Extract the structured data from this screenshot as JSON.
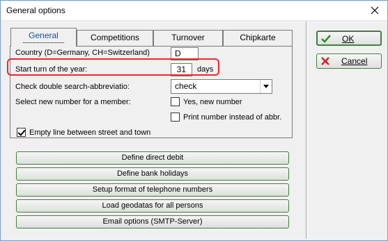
{
  "window": {
    "title": "General options"
  },
  "tabs": [
    {
      "label": "General",
      "active": true
    },
    {
      "label": "Competitions",
      "active": false
    },
    {
      "label": "Turnover",
      "active": false
    },
    {
      "label": "Chipkarte",
      "active": false
    }
  ],
  "general": {
    "country_label": "Country (D=Germany, CH=Switzerland)",
    "country_value": "D",
    "start_turn_label": "Start turn of the year:",
    "start_turn_value": "31",
    "start_turn_unit": "days",
    "double_search_label": "Check double search-abbreviatio:",
    "double_search_value": "check",
    "new_number_label": "Select new number for a member:",
    "yes_new_number_label": "Yes, new number",
    "yes_new_number_checked": false,
    "print_number_label": "Print number instead of abbr.",
    "print_number_checked": false,
    "empty_line_label": "Empty line between street and town",
    "empty_line_checked": true
  },
  "actions": [
    "Define direct debit",
    "Define bank holidays",
    "Setup format of telephone numbers",
    "Load geodatas for all persons",
    "Email options (SMTP-Server)"
  ],
  "buttons": {
    "ok": "OK",
    "cancel": "Cancel"
  },
  "colors": {
    "highlight": "#e62b2b",
    "ok_icon": "#2e8b2e",
    "cancel_icon": "#d42020",
    "button_border": "#3f7f3f"
  }
}
